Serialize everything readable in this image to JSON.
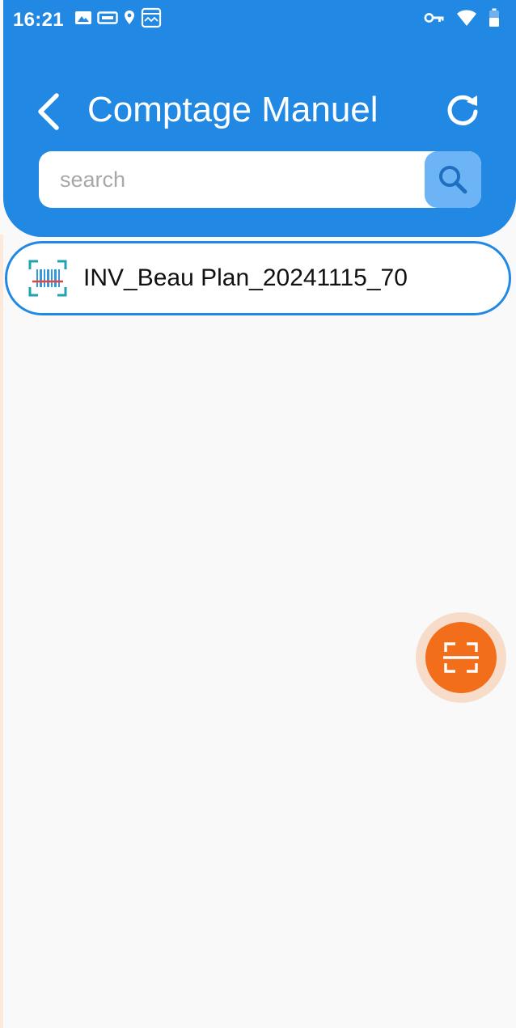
{
  "status_bar": {
    "time": "16:21"
  },
  "header": {
    "title": "Comptage Manuel"
  },
  "search": {
    "placeholder": "search",
    "value": ""
  },
  "inventory_list": {
    "items": [
      {
        "label": "INV_Beau Plan_20241115_70",
        "icon": "barcode-scan-icon"
      }
    ]
  },
  "icons": {
    "back": "chevron-left-icon",
    "refresh": "refresh-icon",
    "search": "search-icon",
    "fab": "scan-icon"
  },
  "colors": {
    "primary": "#2188e4",
    "search_button": "#6db4f6",
    "fab": "#f26e1a",
    "fab_halo": "#f7ddc9",
    "background": "#f9f9f9",
    "barcode_teal": "#1ea3b4",
    "barcode_line": "#e8413c"
  }
}
